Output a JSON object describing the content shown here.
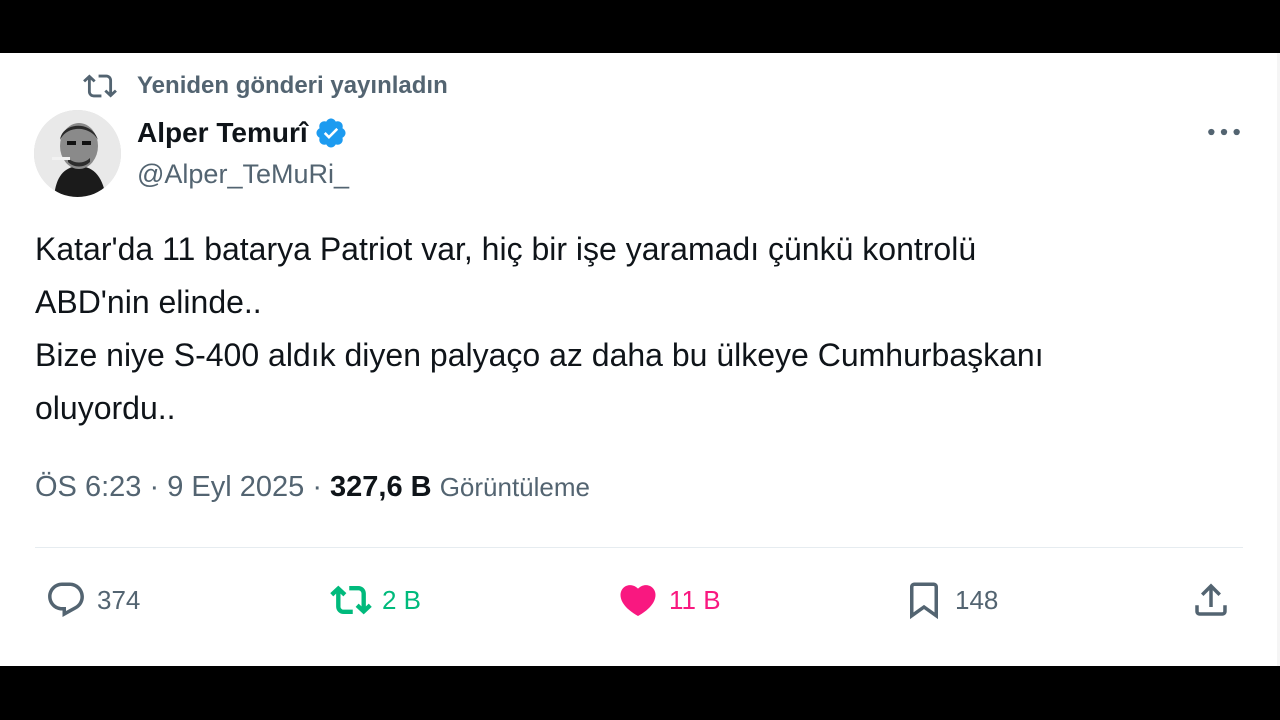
{
  "repost": {
    "label": "Yeniden gönderi yayınladın"
  },
  "author": {
    "name": "Alper Temurî",
    "handle": "@Alper_TeMuRi_",
    "verified": true
  },
  "tweet": {
    "lines": [
      "Katar'da 11 batarya Patriot var, hiç bir işe yaramadı çünkü kontrolü",
      "ABD'nin elinde..",
      "Bize niye S-400 aldık diyen palyaço az daha bu ülkeye Cumhurbaşkanı",
      "oluyordu.."
    ]
  },
  "meta": {
    "time": "ÖS 6:23",
    "separator": "·",
    "date": "9 Eyl 2025",
    "views_count": "327,6 B",
    "views_label": "Görüntüleme"
  },
  "actions": {
    "reply_count": "374",
    "repost_count": "2 B",
    "like_count": "11 B",
    "bookmark_count": "148"
  },
  "icons": {
    "repost": "repost-icon",
    "verified": "verified-badge-icon",
    "more": "more-icon",
    "reply": "reply-icon",
    "like": "heart-icon",
    "bookmark": "bookmark-icon",
    "share": "share-icon"
  },
  "colors": {
    "text": "#0f1419",
    "secondary": "#536471",
    "verified": "#1d9bf0",
    "repost": "#00ba7c",
    "like": "#f91880",
    "background": "#ffffff"
  }
}
